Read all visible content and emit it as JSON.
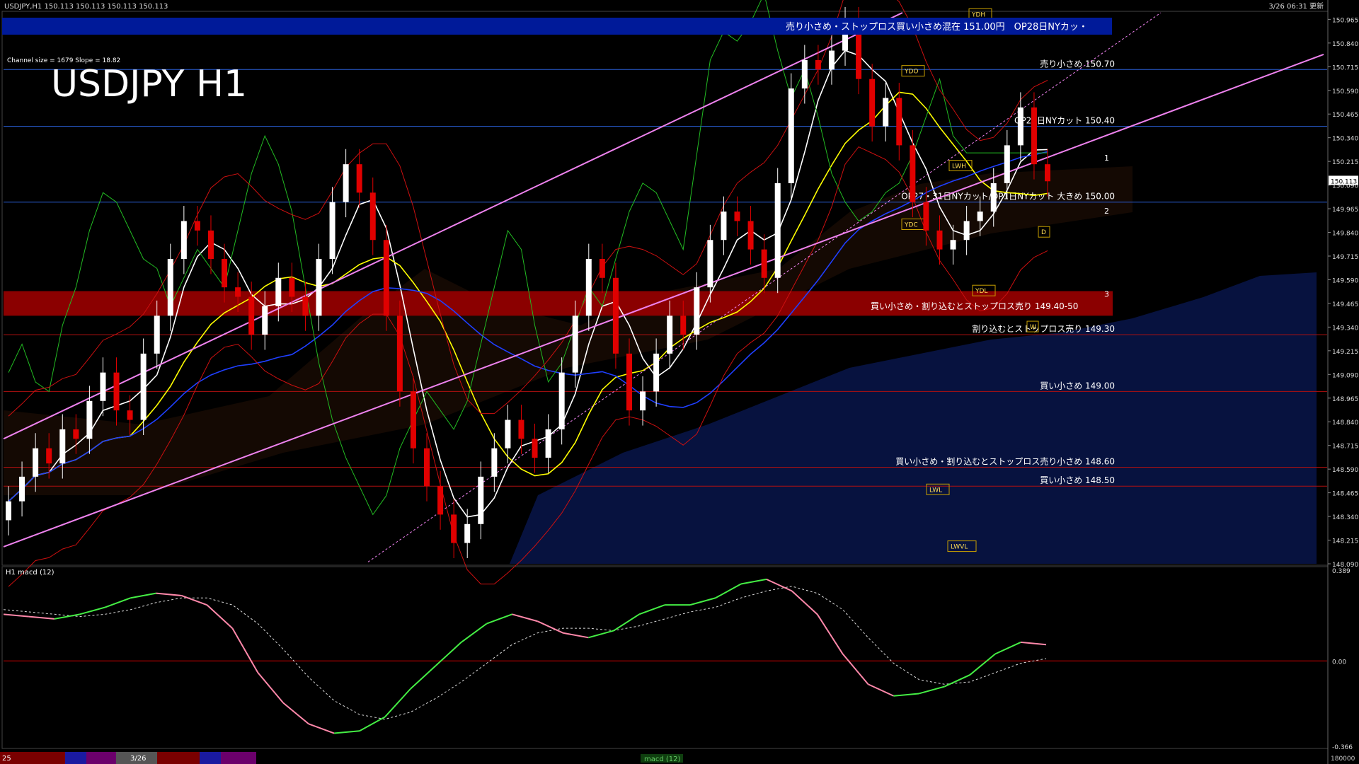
{
  "header": {
    "symbol_line": "USDJPY,H1  150.113 150.113 150.113 150.113",
    "updated": "3/26 06:31 更新"
  },
  "overlay": {
    "title": "USDJPY H1",
    "channel_info": "Channel size = 1679 Slope = 18.82",
    "top_banner": "売り小さめ・ストップロス買い小さめ混在 151.00円　OP28日NYカッ・",
    "zone_label": "買い小さめ・割り込むとストップロス売り 149.40-50"
  },
  "chart_data": {
    "type": "line",
    "title": "USDJPY H1",
    "ylim": [
      148.09,
      151.0
    ],
    "y_ticks": [
      "150.965",
      "150.840",
      "150.715",
      "150.590",
      "150.465",
      "150.340",
      "150.215",
      "150.090",
      "149.965",
      "149.840",
      "149.715",
      "149.590",
      "149.465",
      "149.340",
      "149.215",
      "149.090",
      "148.965",
      "148.840",
      "148.715",
      "148.590",
      "148.465",
      "148.340",
      "148.215",
      "148.090"
    ],
    "current_price": "150.113",
    "levels": [
      {
        "price": 150.7,
        "label": "売り小さめ 150.70",
        "color": "#2a5fd6"
      },
      {
        "price": 150.4,
        "label": "OP28日NYカット 150.40",
        "color": "#2a5fd6"
      },
      {
        "price": 150.0,
        "label": "OP27・31日NYカット/OP1日NYカット 大きめ 150.00",
        "color": "#2a5fd6"
      },
      {
        "price": 149.3,
        "label": "割り込むとストップロス売り 149.30",
        "color": "#b01010"
      },
      {
        "price": 149.0,
        "label": "買い小さめ 149.00",
        "color": "#b01010"
      },
      {
        "price": 148.6,
        "label": "買い小さめ・割り込むとストップロス売り小さめ 148.60",
        "color": "#b01010"
      },
      {
        "price": 148.5,
        "label": "買い小さめ 148.50",
        "color": "#b01010"
      }
    ],
    "box_labels": [
      "YDH",
      "YDO",
      "YDC",
      "YDL",
      "LWH",
      "LWL",
      "LWVL",
      "D",
      "W"
    ],
    "trend_marks": [
      "1",
      "2",
      "3"
    ],
    "close_series": [
      148.42,
      148.55,
      148.7,
      148.62,
      148.8,
      148.75,
      148.95,
      149.1,
      148.9,
      148.85,
      149.2,
      149.4,
      149.7,
      149.9,
      149.85,
      149.7,
      149.55,
      149.5,
      149.3,
      149.45,
      149.6,
      149.5,
      149.4,
      149.7,
      150.0,
      150.2,
      150.05,
      149.8,
      149.4,
      149.0,
      148.7,
      148.5,
      148.35,
      148.2,
      148.3,
      148.55,
      148.7,
      148.85,
      148.75,
      148.65,
      148.8,
      149.1,
      149.4,
      149.7,
      149.6,
      149.2,
      148.9,
      149.0,
      149.2,
      149.4,
      149.3,
      149.55,
      149.8,
      149.95,
      149.9,
      149.75,
      149.6,
      150.1,
      150.6,
      150.75,
      150.7,
      150.8,
      150.95,
      150.65,
      150.4,
      150.55,
      150.3,
      150.0,
      149.85,
      149.75,
      149.8,
      149.9,
      149.95,
      150.1,
      150.3,
      150.5,
      150.2,
      150.11
    ],
    "macd": {
      "title": "H1 macd (12)",
      "ylim": [
        -0.366,
        0.389
      ],
      "y_ticks": [
        "0.389",
        "0.00",
        "-0.366"
      ],
      "main": [
        0.2,
        0.19,
        0.18,
        0.2,
        0.23,
        0.27,
        0.29,
        0.28,
        0.24,
        0.14,
        -0.05,
        -0.18,
        -0.27,
        -0.31,
        -0.3,
        -0.24,
        -0.12,
        -0.02,
        0.08,
        0.16,
        0.2,
        0.17,
        0.12,
        0.1,
        0.13,
        0.2,
        0.24,
        0.24,
        0.27,
        0.33,
        0.35,
        0.3,
        0.2,
        0.03,
        -0.1,
        -0.15,
        -0.14,
        -0.11,
        -0.06,
        0.03,
        0.08,
        0.07
      ],
      "signal": [
        0.22,
        0.21,
        0.2,
        0.19,
        0.2,
        0.22,
        0.25,
        0.27,
        0.27,
        0.24,
        0.16,
        0.05,
        -0.07,
        -0.17,
        -0.23,
        -0.25,
        -0.22,
        -0.16,
        -0.09,
        -0.01,
        0.07,
        0.12,
        0.14,
        0.14,
        0.13,
        0.15,
        0.18,
        0.21,
        0.23,
        0.27,
        0.3,
        0.32,
        0.29,
        0.22,
        0.1,
        -0.01,
        -0.08,
        -0.1,
        -0.09,
        -0.05,
        -0.01,
        0.01
      ]
    }
  },
  "footer": {
    "date_tag": "3/26",
    "panel_tab": "macd (12)",
    "left_tag": "25",
    "right_value": "180000"
  },
  "colors": {
    "background": "#000000",
    "grid": "#3a3a3a",
    "bull_candle": "#ffffff",
    "bear_candle": "#e00000",
    "banner": "#001a99",
    "zone": "#8b0000",
    "channel": "#ee82ee",
    "ma_white": "#ffffff",
    "ma_yellow": "#ffff00",
    "ma_blue": "#1f3fff",
    "lagging": "#22bb22",
    "macd_main_up": "#44ee44",
    "macd_main_down": "#ff88aa"
  }
}
